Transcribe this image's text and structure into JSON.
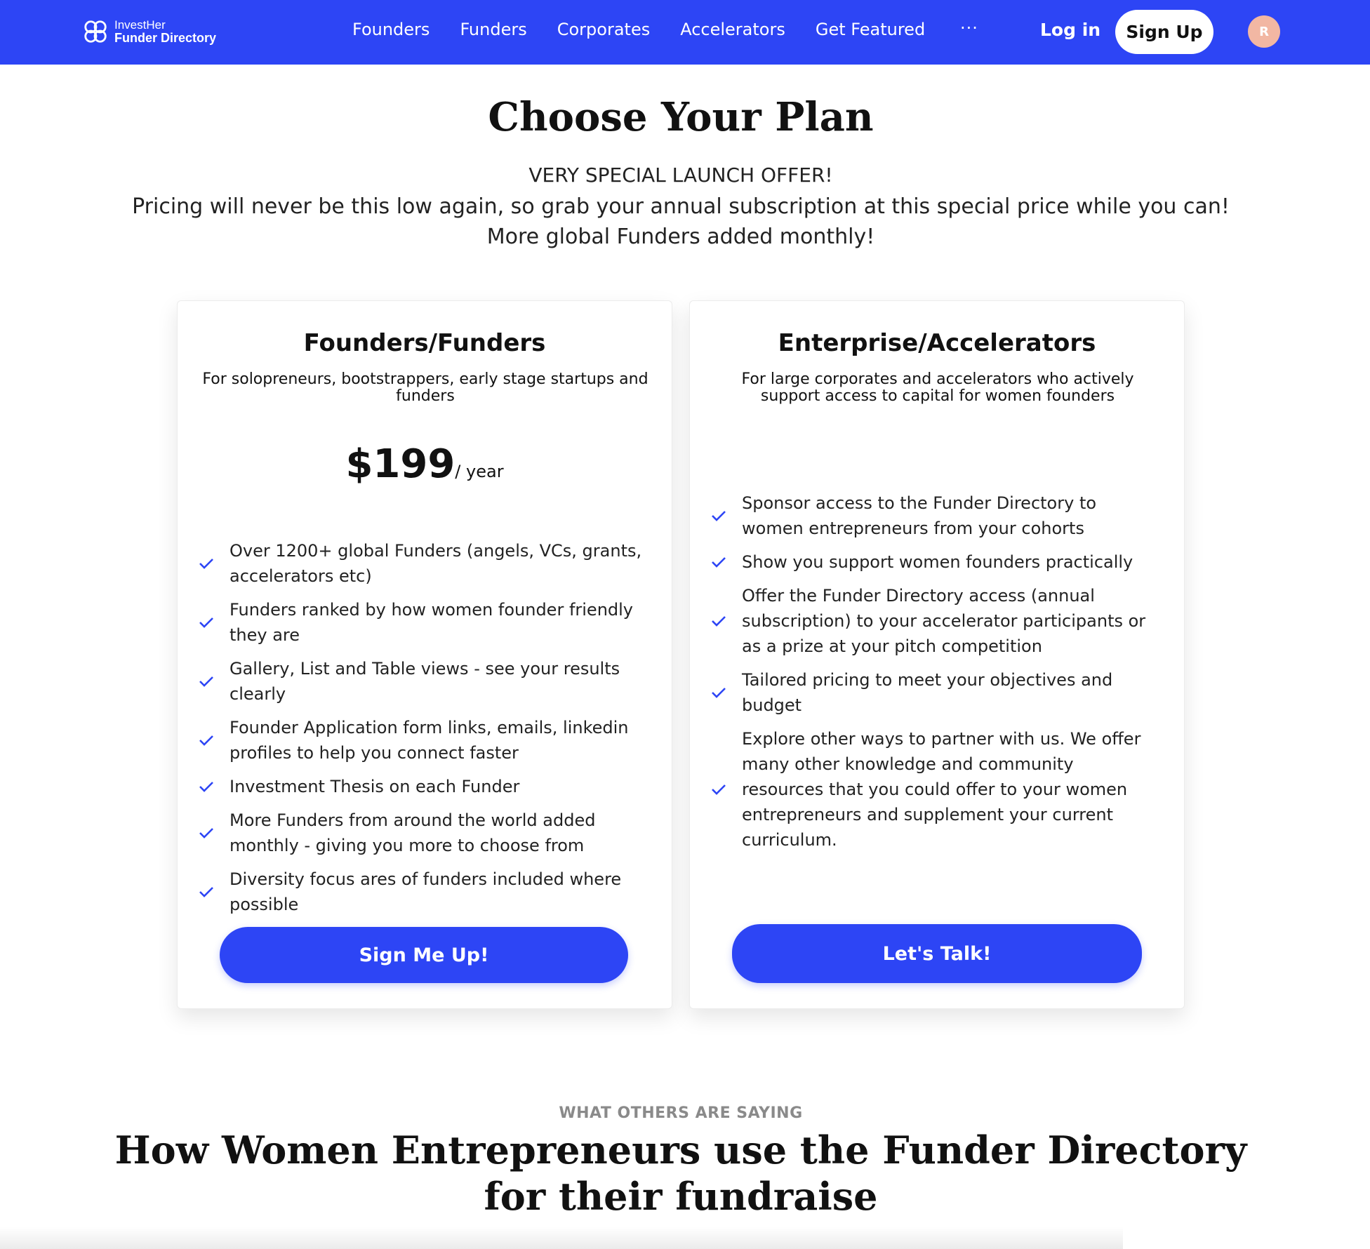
{
  "nav": {
    "logo_line1": "InvestHer",
    "logo_line2": "Funder Directory",
    "links": [
      "Founders",
      "Funders",
      "Corporates",
      "Accelerators",
      "Get Featured"
    ],
    "more": "···",
    "login": "Log in",
    "signup": "Sign Up",
    "avatar_initial": "R",
    "brand_color": "#2d45f5",
    "avatar_color": "#f2b7a3"
  },
  "hero": {
    "title": "Choose Your Plan",
    "line1": "VERY SPECIAL LAUNCH OFFER!",
    "line2": "Pricing will never be this low again, so grab your annual subscription at this special price while you can!",
    "line3": "More global Funders added monthly!"
  },
  "plans": [
    {
      "title": "Founders/Funders",
      "subtitle": "For solopreneurs, bootstrappers, early stage startups and funders",
      "price": "$199",
      "period": "/ year",
      "features": [
        "Over 1200+ global Funders (angels, VCs, grants, accelerators etc)",
        "Funders ranked by how women founder friendly they are",
        "Gallery, List and Table views - see your results clearly",
        "Founder Application form links, emails, linkedin profiles to help you connect faster",
        "Investment Thesis on each Funder",
        "More Funders from around the world added monthly - giving you more to choose from",
        "Diversity focus ares of funders included where possible"
      ],
      "cta": "Sign Me Up!"
    },
    {
      "title": "Enterprise/Accelerators",
      "subtitle": "For large corporates and accelerators who actively support access to capital for women founders",
      "features": [
        "Sponsor access to the Funder Directory to women entrepreneurs from your cohorts",
        "Show you support women founders practically",
        "Offer the Funder Directory access (annual subscription) to your accelerator participants or as a prize at your pitch competition",
        "Tailored pricing to meet your objectives and budget",
        "Explore other ways to partner with us. We offer many other knowledge and community resources that you could offer to your women entrepreneurs and supplement your current curriculum."
      ],
      "cta": "Let's Talk!"
    }
  ],
  "testimonials": {
    "eyebrow": "WHAT OTHERS ARE SAYING",
    "title": "How Women Entrepreneurs use the Funder Directory for their fundraise"
  },
  "icons": {
    "check": "check-icon",
    "logo": "logo-icon"
  }
}
